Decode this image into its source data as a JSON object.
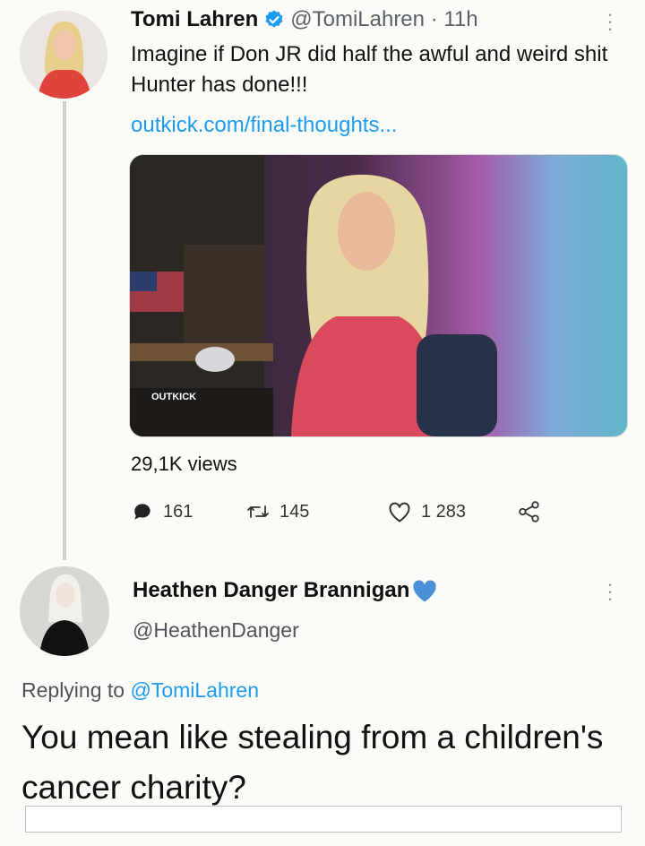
{
  "tweet1": {
    "author_name": "Tomi Lahren",
    "handle_time": "@TomiLahren · 11h",
    "text": "Imagine if Don JR did half the awful and weird shit Hunter has done!!!",
    "link": "outkick.com/final-thoughts...",
    "media_watermark": "OUTKICK",
    "views": "29,1K views",
    "actions": {
      "reply_count": "161",
      "retweet_count": "145",
      "like_count": "1 283"
    }
  },
  "tweet2": {
    "author_name": "Heathen Danger Brannigan",
    "handle": "@HeathenDanger",
    "replying_prefix": "Replying to ",
    "replying_to": "@TomiLahren",
    "text": "You mean like stealing from a children's cancer charity?"
  },
  "colors": {
    "link": "#1d9bf0",
    "verified": "#1d9bf0",
    "heart_emoji": "#4a90d9"
  }
}
